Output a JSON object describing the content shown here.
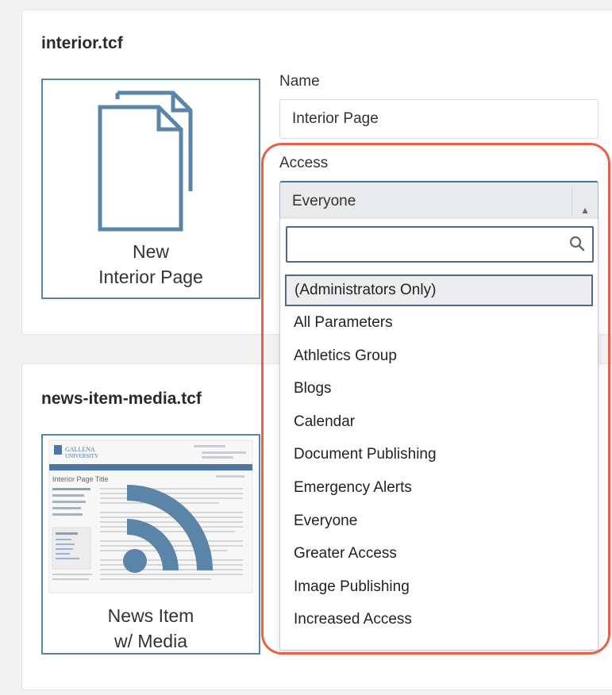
{
  "templates": [
    {
      "filename": "interior.tcf",
      "thumbnail_label_line1": "New",
      "thumbnail_label_line2": "Interior Page"
    },
    {
      "filename": "news-item-media.tcf",
      "thumbnail_label_line1": "News Item",
      "thumbnail_label_line2": "w/ Media",
      "preview": {
        "brand_line1": "GALLENA",
        "brand_line2": "UNIVERSITY",
        "page_title": "Interior Page Title"
      }
    }
  ],
  "form": {
    "name_label": "Name",
    "name_value": "Interior Page",
    "access_label": "Access",
    "access_value": "Everyone"
  },
  "access_dropdown": {
    "search_value": "",
    "options": [
      "(Administrators Only)",
      "All Parameters",
      "Athletics Group",
      "Blogs",
      "Calendar",
      "Document Publishing",
      "Emergency Alerts",
      "Everyone",
      "Greater Access",
      "Image Publishing",
      "Increased Access"
    ],
    "highlighted_index": 0
  },
  "icons": {
    "thumbnail1": "new-page-icon",
    "thumbnail2": "rss-feed-icon",
    "search": "search-icon",
    "select_arrow": "caret-up-icon"
  },
  "colors": {
    "icon_blue": "#5b84a9",
    "annotation_red": "#e8604a",
    "focus_border": "#4d6b86"
  }
}
